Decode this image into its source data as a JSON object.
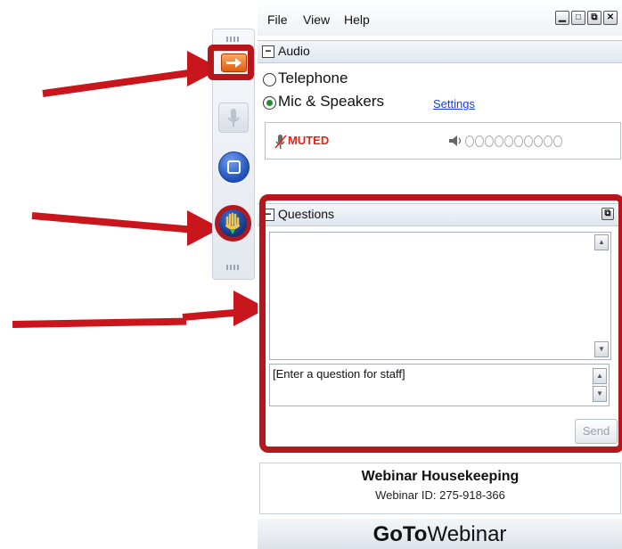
{
  "menu": {
    "file": "File",
    "view": "View",
    "help": "Help"
  },
  "window_buttons": {
    "minimize": "▁",
    "maximize": "□",
    "restore": "⧉",
    "close": "✕"
  },
  "audio": {
    "title": "Audio",
    "telephone_label": "Telephone",
    "mic_label": "Mic & Speakers",
    "settings_link": "Settings",
    "muted_label": "MUTED",
    "selected": "mic"
  },
  "questions": {
    "title": "Questions",
    "input_placeholder": "[Enter a question for staff]",
    "send_label": "Send"
  },
  "webinar": {
    "title": "Webinar Housekeeping",
    "id_text": "Webinar ID: 275-918-366"
  },
  "brand": {
    "bold": "GoTo",
    "regular": "Webinar"
  },
  "colors": {
    "highlight": "#b5171d",
    "muted": "#e0241b",
    "link": "#1a3fd1",
    "orange": "#e45d10"
  },
  "icons": [
    "arrow-right-icon",
    "microphone-icon",
    "square-icon",
    "raised-hand-icon",
    "speaker-icon"
  ]
}
